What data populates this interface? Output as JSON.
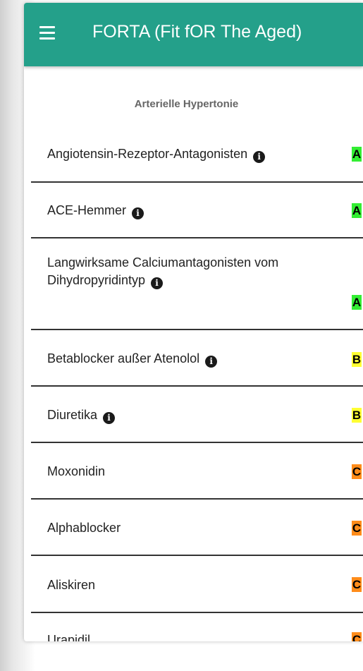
{
  "appbar": {
    "title": "FORTA (Fit fOR The Aged)",
    "menu_icon": "hamburger-menu-icon",
    "color": "#24a08a"
  },
  "section": {
    "title": "Arterielle Hypertonie"
  },
  "badge_colors": {
    "A": "#33ee33",
    "B": "#ffff33",
    "C": "#ff8c1a"
  },
  "items": [
    {
      "label": "Angiotensin-Rezeptor-Antagonisten",
      "info": true,
      "rating": "A"
    },
    {
      "label": "ACE-Hemmer",
      "info": true,
      "rating": "A"
    },
    {
      "label": "Langwirksame Calciumantagonisten vom Dihydropyridintyp",
      "info": true,
      "rating": "A"
    },
    {
      "label": "Betablocker außer Atenolol",
      "info": true,
      "rating": "B"
    },
    {
      "label": "Diuretika",
      "info": true,
      "rating": "B"
    },
    {
      "label": "Moxonidin",
      "info": false,
      "rating": "C"
    },
    {
      "label": "Alphablocker",
      "info": false,
      "rating": "C"
    },
    {
      "label": "Aliskiren",
      "info": false,
      "rating": "C"
    },
    {
      "label": "Urapidil",
      "info": false,
      "rating": "C"
    }
  ]
}
